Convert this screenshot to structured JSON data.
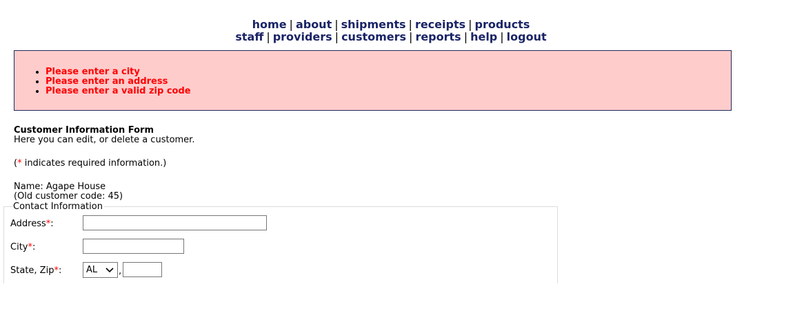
{
  "nav": {
    "row1": [
      "home",
      "about",
      "shipments",
      "receipts",
      "products"
    ],
    "row2": [
      "staff",
      "providers",
      "customers",
      "reports",
      "help",
      "logout"
    ],
    "separator": "|"
  },
  "errors": [
    "Please enter a city",
    "Please enter an address",
    "Please enter a valid zip code"
  ],
  "form": {
    "title": "Customer Information Form",
    "description": "Here you can edit, or delete a customer.",
    "required_note_open": "(",
    "required_star": "*",
    "required_note_rest": " indicates required information.)",
    "name_line": "Name: Agape House",
    "old_code_line": "(Old customer code: 45)"
  },
  "contact": {
    "legend": "Contact Information",
    "address_label": "Address",
    "city_label": "City",
    "state_zip_label": "State, Zip",
    "label_suffix": ":",
    "star": "*",
    "address_value": "",
    "city_value": "",
    "state_selected": "AL",
    "zip_value": "",
    "comma": ","
  },
  "colors": {
    "nav_link": "#1a2466",
    "error_bg": "#ffcccc",
    "error_border": "#1f2a5c",
    "error_text": "#ff0000",
    "required_star": "#ff0000"
  }
}
